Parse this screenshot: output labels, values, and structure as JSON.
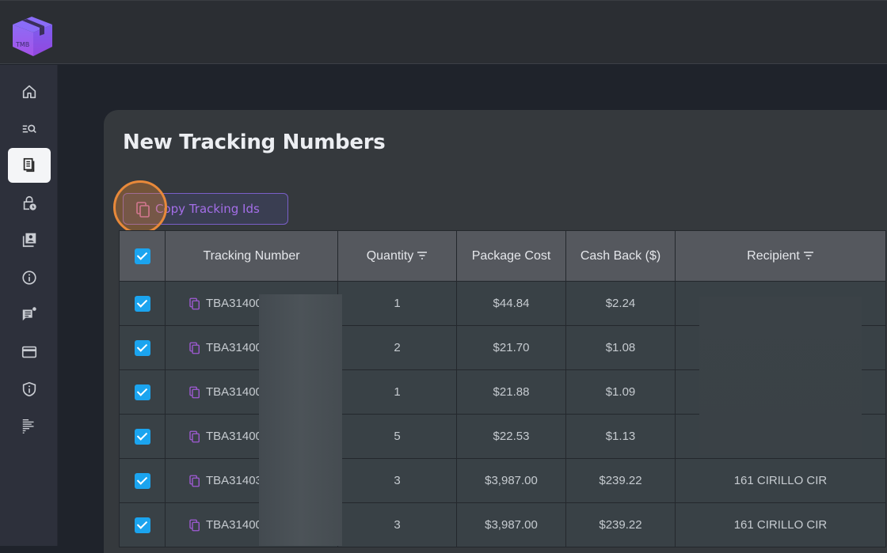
{
  "app": {
    "logo_text": "TMB",
    "brand_color": "#8b5cf6"
  },
  "sidebar": {
    "items": [
      {
        "name": "home",
        "icon": "home-icon",
        "active": false
      },
      {
        "name": "search-list",
        "icon": "list-search-icon",
        "active": false
      },
      {
        "name": "documents",
        "icon": "documents-icon",
        "active": true
      },
      {
        "name": "lock-clock",
        "icon": "lock-clock-icon",
        "active": false
      },
      {
        "name": "contacts",
        "icon": "contacts-icon",
        "active": false
      },
      {
        "name": "info",
        "icon": "info-icon",
        "active": false
      },
      {
        "name": "announcements",
        "icon": "chat-notification-icon",
        "active": false
      },
      {
        "name": "payment",
        "icon": "credit-card-icon",
        "active": false
      },
      {
        "name": "security",
        "icon": "shield-info-icon",
        "active": false
      },
      {
        "name": "reports",
        "icon": "text-lines-icon",
        "active": false
      }
    ]
  },
  "page": {
    "title": "New Tracking Numbers",
    "copy_button_label": "Copy Tracking Ids"
  },
  "table": {
    "columns": [
      {
        "label": "",
        "type": "checkbox",
        "checked": true
      },
      {
        "label": "Tracking Number",
        "sortable": false
      },
      {
        "label": "Quantity",
        "sortable": true
      },
      {
        "label": "Package Cost",
        "sortable": false
      },
      {
        "label": "Cash Back ($)",
        "sortable": false
      },
      {
        "label": "Recipient",
        "sortable": true
      }
    ],
    "rows": [
      {
        "checked": true,
        "tracking": "TBA31400",
        "quantity": "1",
        "package_cost": "$44.84",
        "cash_back": "$2.24",
        "recipient": ""
      },
      {
        "checked": true,
        "tracking": "TBA31400",
        "quantity": "2",
        "package_cost": "$21.70",
        "cash_back": "$1.08",
        "recipient": ""
      },
      {
        "checked": true,
        "tracking": "TBA31400",
        "quantity": "1",
        "package_cost": "$21.88",
        "cash_back": "$1.09",
        "recipient": ""
      },
      {
        "checked": true,
        "tracking": "TBA31400",
        "quantity": "5",
        "package_cost": "$22.53",
        "cash_back": "$1.13",
        "recipient": ""
      },
      {
        "checked": true,
        "tracking": "TBA31403",
        "quantity": "3",
        "package_cost": "$3,987.00",
        "cash_back": "$239.22",
        "recipient": "161 CIRILLO CIR"
      },
      {
        "checked": true,
        "tracking": "TBA31400",
        "quantity": "3",
        "package_cost": "$3,987.00",
        "cash_back": "$239.22",
        "recipient": "161 CIRILLO CIR"
      }
    ]
  }
}
